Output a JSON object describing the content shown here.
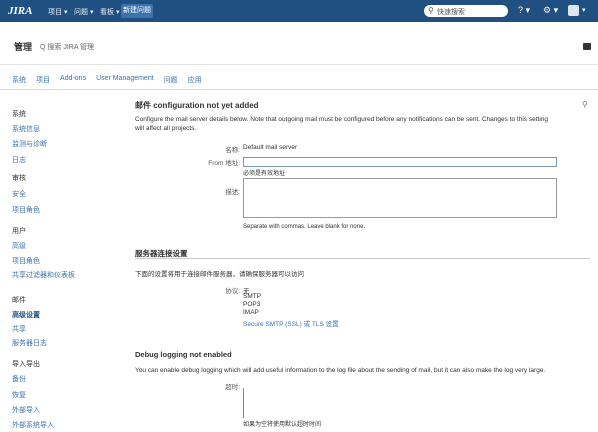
{
  "topnav": {
    "logo": "JIRA",
    "menus": [
      "项目 ▾",
      "问题 ▾",
      "看板 ▾"
    ],
    "create": "新建问题",
    "search_placeholder": "快速搜索",
    "help_glyph": "? ▾",
    "gear_glyph": "⚙ ▾",
    "avatar_caret": "▾",
    "bar_color": "#205081"
  },
  "header": {
    "title": "管理",
    "search": "Q 搜索 JIRA 管理"
  },
  "tabs": [
    "系统",
    "项目",
    "Add-ons",
    "User Management",
    "问题",
    "应用"
  ],
  "sidebar": {
    "items": [
      {
        "label": "系统",
        "heading": true
      },
      {
        "label": "系统信息"
      },
      {
        "label": "监测与诊断"
      },
      {
        "label": "日志"
      },
      {
        "label": "审核",
        "heading": true
      },
      {
        "label": "安全"
      },
      {
        "label": "项目角色"
      },
      {
        "label": "用户",
        "heading": true
      },
      {
        "label": "高级"
      },
      {
        "label": "项目角色"
      },
      {
        "label": "共享过滤器和仪表板"
      },
      {
        "label": "邮件",
        "heading": true
      },
      {
        "label": "高级设置",
        "selected": true
      },
      {
        "label": "共享"
      },
      {
        "label": "服务器日志"
      },
      {
        "label": "导入导出",
        "heading": true
      },
      {
        "label": "备份"
      },
      {
        "label": "恢复"
      },
      {
        "label": "外部导入"
      },
      {
        "label": "外部系统导入"
      }
    ]
  },
  "main": {
    "title": "邮件 configuration not yet added",
    "desc1": "Configure the mail server details below. Note that outgoing mail must be configured before any notifications can be sent. Changes to this setting",
    "desc2": "will affect all projects.",
    "name_label": "名称:",
    "name_value": "Default mail server",
    "from_label": "From 地址:",
    "from_help": "必须是有效地址",
    "desc_label": "描述:",
    "desc_help": "Separate with commas. Leave blank for none.",
    "section2": {
      "heading": "服务器连接设置",
      "desc": "下面的设置将用于连接邮件服务器，请确保服务器可以访问",
      "protocol_label": "协议:",
      "options": [
        "无",
        "SMTP",
        "POP3",
        "IMAP",
        "Secure SMTP (SSL) 或 TLS 设置"
      ]
    },
    "section3": {
      "heading": "Debug logging not enabled",
      "desc": "You can enable debug logging which will add useful information to the log file about the sending of mail, but it can also make the log very large.",
      "timeout_label": "超时:",
      "timeout_help": "如果为空将使用默认超时时间"
    }
  }
}
